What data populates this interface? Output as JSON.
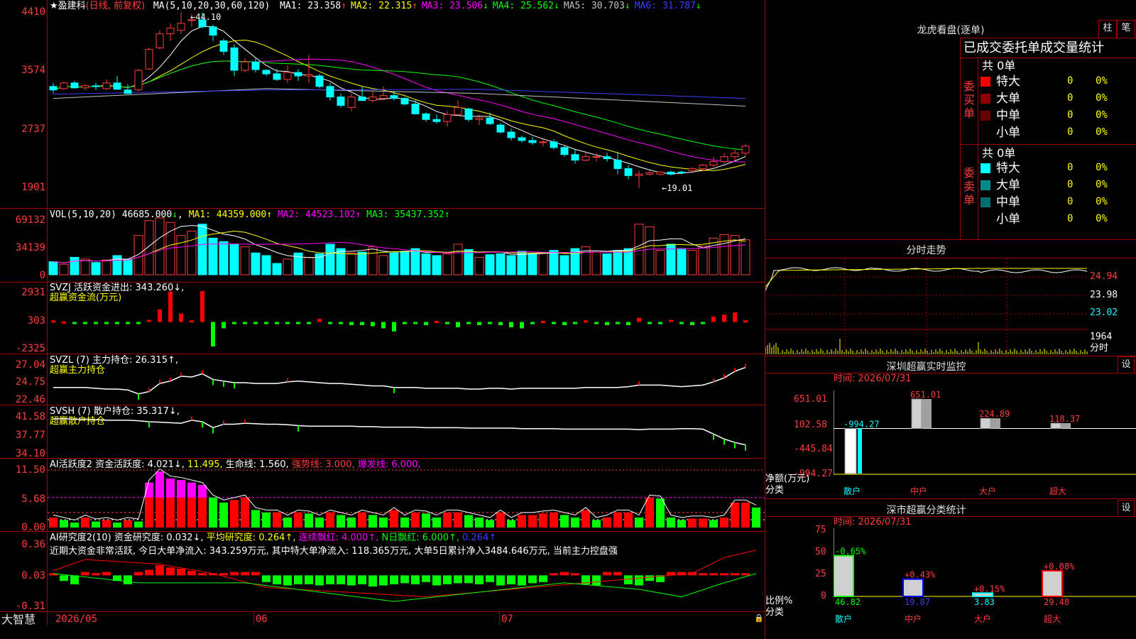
{
  "app_name": "大智慧",
  "stock": {
    "star": "★",
    "name": "盈建科",
    "mode": "(日线, 前复权)"
  },
  "ma_header": {
    "label": "MA(5,10,20,30,60,120)",
    "items": [
      {
        "k": "MA1:",
        "v": "23.358",
        "arrow": "↑",
        "color": "#ffffff",
        "acolor": "#ff3c3c"
      },
      {
        "k": "MA2:",
        "v": "22.315",
        "arrow": "↑",
        "color": "#ffff00",
        "acolor": "#ff3c3c"
      },
      {
        "k": "MA3:",
        "v": "23.506",
        "arrow": "↓",
        "color": "#ff00ff",
        "acolor": "#00ff00"
      },
      {
        "k": "MA4:",
        "v": "25.562",
        "arrow": "↓",
        "color": "#00ff00",
        "acolor": "#00ff00"
      },
      {
        "k": "MA5:",
        "v": "30.703",
        "arrow": "↓",
        "color": "#c0c0c0",
        "acolor": "#00ff00"
      },
      {
        "k": "MA6:",
        "v": "31.787",
        "arrow": "↓",
        "color": "#3c3cff",
        "acolor": "#00ff00"
      }
    ]
  },
  "price_axis": [
    "4410",
    "3574",
    "2737",
    "1901"
  ],
  "price_annotations": {
    "high": "44.10",
    "low": "←19.01"
  },
  "vol_header": {
    "label": "VOL(5,10,20)",
    "v": "46685.000",
    "arrow": "↓",
    "ma1": "MA1: 44359.000↑",
    "ma2": "MA2: 44523.102↑",
    "ma3": "MA3: 35437.352↑"
  },
  "vol_axis": [
    "69132",
    "34139",
    "0"
  ],
  "svzj": {
    "title": "SVZJ  活跃资金进出: 343.260↓,",
    "subtitle": "超赢资金流(万元)",
    "axis": [
      "2931",
      "303",
      "-2325"
    ]
  },
  "svzl": {
    "title": "SVZL (7) 主力持仓: 26.315↑,",
    "subtitle": "超赢主力持仓",
    "axis": [
      "27.04",
      "24.75",
      "22.46"
    ]
  },
  "svsh": {
    "title": "SVSH (7) 散户持仓: 35.317↓,",
    "subtitle": "超赢散户持仓",
    "axis": [
      "41.58",
      "37.77",
      "34.10"
    ]
  },
  "ai_active": {
    "t1": "AI活跃度2 资金活跃度: 4.021↓,",
    "t2": "11.495,",
    "t3": "生命线: 1.560,",
    "t4": "强势线: 3.000,",
    "t5": "爆发线: 6.000,",
    "axis": [
      "11.50",
      "5.68",
      "0.00"
    ]
  },
  "ai_research": {
    "t1": "AI研究度2(10) 资金研究度: 0.032↓,",
    "t2": "平均研究度: 0.264↑,",
    "t3": "连续飘红: 4.000↑,",
    "t4": "N日飘红: 6.000↑,",
    "t5": "0.264↑",
    "summary": "近期大资金非常活跃, 今日大单净流入: 343.259万元, 其中特大单净流入: 118.365万元, 大单5日累计净入3484.646万元, 当前主力控盘强",
    "axis": [
      "0.36",
      "0.03",
      "-0.31"
    ]
  },
  "date_axis": [
    "2026/05",
    "06",
    "07"
  ],
  "right_panel": {
    "dragon_title": "龙虎看盘(逐单)",
    "btn1": "柱",
    "btn2": "笔",
    "stat_title": "已成交委托单成交量统计",
    "buy_label": "委买单",
    "sell_label": "委卖单",
    "buy_total": "共 0单",
    "sell_total": "共 0单",
    "buy_rows": [
      {
        "name": "特大",
        "v": "0",
        "p": "0%",
        "color": "#ff0000"
      },
      {
        "name": "大单",
        "v": "0",
        "p": "0%",
        "color": "#8b0000"
      },
      {
        "name": "中单",
        "v": "0",
        "p": "0%",
        "color": "#6b0000"
      },
      {
        "name": "小单",
        "v": "0",
        "p": "0%",
        "color": "#000000"
      }
    ],
    "sell_rows": [
      {
        "name": "特大",
        "v": "0",
        "p": "0%",
        "color": "#00ffff"
      },
      {
        "name": "大单",
        "v": "0",
        "p": "0%",
        "color": "#008b8b"
      },
      {
        "name": "中单",
        "v": "0",
        "p": "0%",
        "color": "#007070"
      },
      {
        "name": "小单",
        "v": "0",
        "p": "0%",
        "color": "#000000"
      }
    ],
    "intraday_title": "分时走势",
    "intraday_axis": [
      "24.94",
      "23.98",
      "23.02"
    ],
    "intraday_vol": "1964",
    "intraday_unit": "分时",
    "sz_monitor_title": "深圳超赢实时监控",
    "sz_monitor_btn": "设",
    "sz_time": "时间: 2026/07/31",
    "sz_axis": [
      "651.01",
      "102.58",
      "-445.84",
      "-994.27"
    ],
    "sz_ylabel": "净额(万元)",
    "sz_xlabel": "分类",
    "sz_cats": [
      "散户",
      "中户",
      "大户",
      "超大"
    ],
    "sz_values": [
      -994.27,
      651.01,
      224.89,
      118.37
    ],
    "sz_value_labels": [
      "-994.27",
      "651.01",
      "224.89",
      "118.37"
    ],
    "cls_title": "深市超赢分类统计",
    "cls_btn": "设",
    "cls_time": "时间: 2026/07/31",
    "cls_axis": [
      "75",
      "50",
      "25",
      "0"
    ],
    "cls_ylabel": "比例%",
    "cls_xlabel": "分类",
    "cls_cats": [
      "散户",
      "中户",
      "大户",
      "超大"
    ],
    "cls_values": [
      46.82,
      19.87,
      3.83,
      29.48
    ],
    "cls_changes": [
      "-0.65%",
      "+0.43%",
      "+0.15%",
      "+0.08%"
    ],
    "cls_value_labels": [
      "46.82",
      "19.87",
      "3.83",
      "29.48"
    ]
  },
  "chart_data": [
    {
      "type": "candlestick",
      "title": "盈建科 日线 前复权",
      "ylim": [
        19.01,
        44.1
      ],
      "x_range": [
        "2026/05",
        "2026/07/31"
      ],
      "ohlc": [
        [
          33.5,
          34.0,
          32.5,
          33.0
        ],
        [
          33.2,
          34.2,
          33.0,
          34.0
        ],
        [
          34.0,
          34.3,
          33.2,
          33.3
        ],
        [
          33.3,
          33.8,
          33.0,
          33.6
        ],
        [
          33.6,
          34.0,
          33.0,
          33.5
        ],
        [
          33.2,
          34.5,
          33.0,
          34.0
        ],
        [
          34.0,
          35.0,
          33.0,
          33.1
        ],
        [
          33.0,
          33.8,
          32.4,
          32.5
        ],
        [
          33.0,
          36.0,
          32.8,
          35.8
        ],
        [
          36.0,
          39.0,
          35.8,
          38.8
        ],
        [
          39.0,
          41.5,
          38.8,
          41.0
        ],
        [
          41.0,
          42.5,
          40.0,
          41.8
        ],
        [
          41.5,
          44.1,
          41.0,
          42.5
        ],
        [
          43.0,
          43.8,
          42.0,
          43.0
        ],
        [
          43.0,
          44.0,
          41.8,
          42.0
        ],
        [
          42.0,
          42.3,
          40.0,
          40.8
        ],
        [
          40.0,
          40.3,
          38.0,
          38.5
        ],
        [
          39.0,
          39.5,
          35.0,
          35.8
        ],
        [
          35.8,
          37.5,
          35.5,
          37.0
        ],
        [
          37.0,
          37.5,
          35.5,
          35.9
        ],
        [
          35.8,
          36.0,
          35.0,
          35.3
        ],
        [
          35.3,
          36.0,
          34.3,
          34.5
        ],
        [
          34.5,
          36.5,
          34.0,
          35.5
        ],
        [
          35.5,
          36.0,
          34.3,
          35.0
        ],
        [
          35.0,
          38.0,
          34.0,
          35.2
        ],
        [
          35.0,
          35.3,
          33.2,
          33.5
        ],
        [
          33.5,
          34.0,
          31.5,
          32.0
        ],
        [
          32.0,
          32.5,
          30.5,
          30.8
        ],
        [
          30.5,
          32.5,
          30.0,
          32.0
        ],
        [
          32.0,
          33.5,
          31.5,
          31.5
        ],
        [
          31.5,
          32.8,
          31.2,
          32.0
        ],
        [
          31.8,
          33.5,
          31.5,
          32.2
        ],
        [
          32.2,
          32.8,
          31.5,
          31.8
        ],
        [
          31.8,
          32.0,
          30.8,
          31.0
        ],
        [
          31.0,
          31.5,
          29.5,
          29.6
        ],
        [
          29.6,
          29.8,
          28.5,
          28.8
        ],
        [
          28.8,
          29.5,
          28.2,
          28.5
        ],
        [
          28.5,
          30.0,
          27.8,
          29.5
        ],
        [
          29.5,
          31.5,
          29.3,
          30.5
        ],
        [
          30.3,
          30.5,
          28.5,
          28.8
        ],
        [
          28.8,
          29.5,
          28.0,
          29.0
        ],
        [
          29.0,
          29.8,
          28.0,
          28.2
        ],
        [
          28.0,
          28.3,
          26.8,
          27.0
        ],
        [
          27.0,
          27.5,
          25.8,
          26.2
        ],
        [
          26.2,
          26.5,
          25.5,
          25.8
        ],
        [
          25.8,
          26.3,
          25.2,
          25.5
        ],
        [
          25.5,
          26.0,
          25.0,
          25.6
        ],
        [
          25.6,
          26.0,
          24.5,
          24.8
        ],
        [
          24.8,
          25.0,
          23.5,
          23.8
        ],
        [
          23.8,
          24.5,
          22.5,
          23.0
        ],
        [
          23.0,
          24.0,
          22.8,
          23.5
        ],
        [
          23.5,
          24.0,
          22.8,
          23.5
        ],
        [
          23.5,
          24.0,
          22.8,
          23.2
        ],
        [
          23.0,
          24.2,
          21.0,
          21.8
        ],
        [
          21.8,
          22.3,
          20.3,
          20.8
        ],
        [
          20.8,
          21.5,
          19.0,
          21.0
        ],
        [
          21.0,
          21.5,
          20.8,
          21.2
        ],
        [
          21.0,
          21.5,
          20.8,
          21.3
        ],
        [
          21.3,
          21.5,
          20.8,
          21.0
        ],
        [
          21.3,
          21.5,
          21.0,
          21.2
        ],
        [
          21.5,
          22.0,
          21.3,
          21.8
        ],
        [
          21.8,
          22.5,
          21.5,
          22.3
        ],
        [
          22.3,
          23.5,
          22.0,
          22.8
        ],
        [
          22.8,
          24.0,
          22.5,
          23.5
        ],
        [
          23.5,
          24.5,
          23.0,
          24.0
        ],
        [
          24.0,
          25.3,
          23.5,
          25.0
        ]
      ]
    },
    {
      "type": "bar",
      "title": "VOL(5,10,20)",
      "ylim": [
        0,
        69132
      ],
      "values": [
        15000,
        12000,
        20000,
        18000,
        14000,
        17000,
        22000,
        18000,
        45000,
        62000,
        65000,
        60000,
        45000,
        50000,
        58000,
        42000,
        38000,
        35000,
        32000,
        25000,
        22000,
        13000,
        18000,
        25000,
        20000,
        24000,
        35000,
        30000,
        25000,
        26000,
        32000,
        22000,
        25000,
        27000,
        30000,
        24000,
        22000,
        24000,
        35000,
        29000,
        20000,
        23000,
        24000,
        22000,
        27000,
        24000,
        25000,
        28000,
        22000,
        30000,
        32000,
        26000,
        24000,
        28000,
        30000,
        58000,
        55000,
        28000,
        35000,
        30000,
        28000,
        33000,
        42000,
        46000,
        45000,
        40000
      ],
      "colors_up": true
    },
    {
      "type": "bar",
      "title": "SVZJ 活跃资金进出",
      "ylim": [
        -2325,
        2931
      ],
      "values": [
        150,
        50,
        -150,
        -100,
        -120,
        -80,
        -100,
        -80,
        -200,
        200,
        1200,
        2900,
        800,
        150,
        2931,
        -2325,
        -600,
        -200,
        -200,
        -150,
        -150,
        -180,
        -100,
        -150,
        -150,
        300,
        -150,
        -150,
        -300,
        -300,
        -400,
        -600,
        -900,
        -150,
        -200,
        -300,
        100,
        -200,
        -500,
        -200,
        -300,
        -100,
        -300,
        -500,
        -600,
        -100,
        100,
        -200,
        -300,
        -200,
        150,
        -100,
        -300,
        -200,
        -300,
        400,
        -150,
        -200,
        200,
        -100,
        -300,
        -200,
        500,
        700,
        900,
        150
      ]
    },
    {
      "type": "line",
      "title": "SVZL (7) 主力持仓",
      "ylim": [
        22.46,
        27.04
      ],
      "values": [
        23.8,
        23.8,
        23.8,
        23.8,
        23.7,
        23.6,
        23.6,
        23.5,
        23.0,
        23.3,
        24.3,
        24.6,
        25.2,
        25.1,
        25.5,
        24.8,
        24.6,
        24.4,
        24.4,
        24.3,
        24.3,
        24.3,
        24.5,
        24.6,
        24.5,
        24.4,
        24.3,
        24.3,
        24.2,
        24.1,
        24.0,
        24.0,
        23.8,
        23.8,
        23.8,
        23.7,
        23.7,
        23.7,
        23.7,
        23.6,
        23.6,
        23.7,
        23.7,
        23.6,
        23.7,
        23.7,
        23.7,
        23.7,
        23.7,
        23.7,
        23.8,
        23.8,
        23.8,
        23.8,
        23.9,
        24.1,
        24.1,
        24.1,
        24.0,
        23.9,
        24.0,
        24.1,
        24.5,
        25.0,
        25.8,
        26.3
      ]
    },
    {
      "type": "line",
      "title": "SVSH (7) 散户持仓",
      "ylim": [
        34.1,
        41.58
      ],
      "values": [
        40.6,
        40.6,
        40.5,
        40.5,
        40.4,
        40.3,
        40.3,
        40.3,
        40.2,
        40.0,
        39.9,
        39.8,
        39.7,
        40.3,
        40.0,
        38.8,
        39.5,
        39.5,
        39.7,
        39.6,
        39.5,
        39.5,
        39.4,
        39.2,
        39.1,
        39.1,
        39.1,
        39.1,
        39.1,
        39.0,
        39.0,
        38.9,
        38.9,
        38.9,
        38.9,
        38.8,
        38.8,
        38.8,
        38.8,
        38.7,
        38.7,
        38.7,
        38.7,
        38.7,
        38.6,
        38.6,
        38.6,
        38.6,
        38.5,
        38.5,
        38.5,
        38.5,
        38.5,
        38.5,
        38.5,
        38.4,
        38.5,
        38.5,
        38.5,
        38.6,
        38.6,
        38.5,
        37.5,
        36.5,
        35.8,
        35.3
      ]
    },
    {
      "type": "bar",
      "title": "AI活跃度2",
      "ylim": [
        0,
        11.5
      ],
      "values": [
        2.0,
        1.5,
        1.0,
        2.0,
        1.2,
        1.5,
        1.0,
        1.5,
        1.2,
        9.0,
        11.2,
        9.8,
        9.5,
        9.0,
        8.5,
        6.0,
        5.0,
        5.5,
        6.0,
        3.5,
        3.0,
        3.0,
        2.0,
        3.0,
        2.8,
        2.0,
        3.0,
        2.5,
        2.0,
        3.0,
        2.5,
        2.0,
        3.5,
        2.0,
        3.0,
        2.8,
        2.0,
        3.0,
        3.0,
        2.5,
        2.0,
        1.5,
        3.0,
        1.5,
        2.5,
        2.5,
        2.8,
        3.0,
        2.5,
        2.0,
        3.5,
        1.5,
        2.0,
        3.0,
        3.0,
        2.0,
        6.0,
        5.8,
        2.0,
        1.5,
        1.8,
        1.8,
        1.5,
        2.0,
        5.0,
        5.0,
        4.0
      ]
    },
    {
      "type": "bar",
      "title": "AI研究度2(10)",
      "ylim": [
        -0.31,
        0.36
      ],
      "values": [
        0.02,
        -0.02,
        -0.05,
        0.0,
        0.01,
        0.0,
        -0.02,
        -0.05,
        0.0,
        0.08,
        0.12,
        0.1,
        0.09,
        0.07,
        0.05,
        0.04,
        0.05,
        0.0,
        0.0,
        0.0,
        -0.03,
        -0.05,
        -0.06,
        -0.05,
        -0.05,
        -0.06,
        -0.05,
        -0.05,
        -0.06,
        -0.05,
        -0.07,
        -0.06,
        -0.05,
        -0.04,
        -0.05,
        -0.03,
        -0.06,
        -0.05,
        -0.04,
        -0.04,
        -0.05,
        -0.03,
        -0.06,
        -0.05,
        -0.06,
        -0.04,
        -0.03,
        0.03,
        0.0,
        0.02,
        -0.05,
        -0.06,
        0.0,
        0.0,
        -0.05,
        -0.06,
        -0.02,
        -0.03,
        0.0,
        0.0,
        0.0,
        0.02,
        0.03,
        0.03,
        0.03,
        0.03
      ]
    },
    {
      "type": "bar",
      "title": "深圳超赢实时监控",
      "categories": [
        "散户",
        "中户",
        "大户",
        "超大"
      ],
      "values": [
        -994.27,
        651.01,
        224.89,
        118.37
      ],
      "ylabel": "净额(万元)",
      "xlabel": "分类",
      "ylim": [
        -994.27,
        651.01
      ]
    },
    {
      "type": "bar",
      "title": "深市超赢分类统计",
      "categories": [
        "散户",
        "中户",
        "大户",
        "超大"
      ],
      "values": [
        46.82,
        19.87,
        3.83,
        29.48
      ],
      "ylabel": "比例%",
      "xlabel": "分类",
      "ylim": [
        0,
        75
      ]
    }
  ]
}
